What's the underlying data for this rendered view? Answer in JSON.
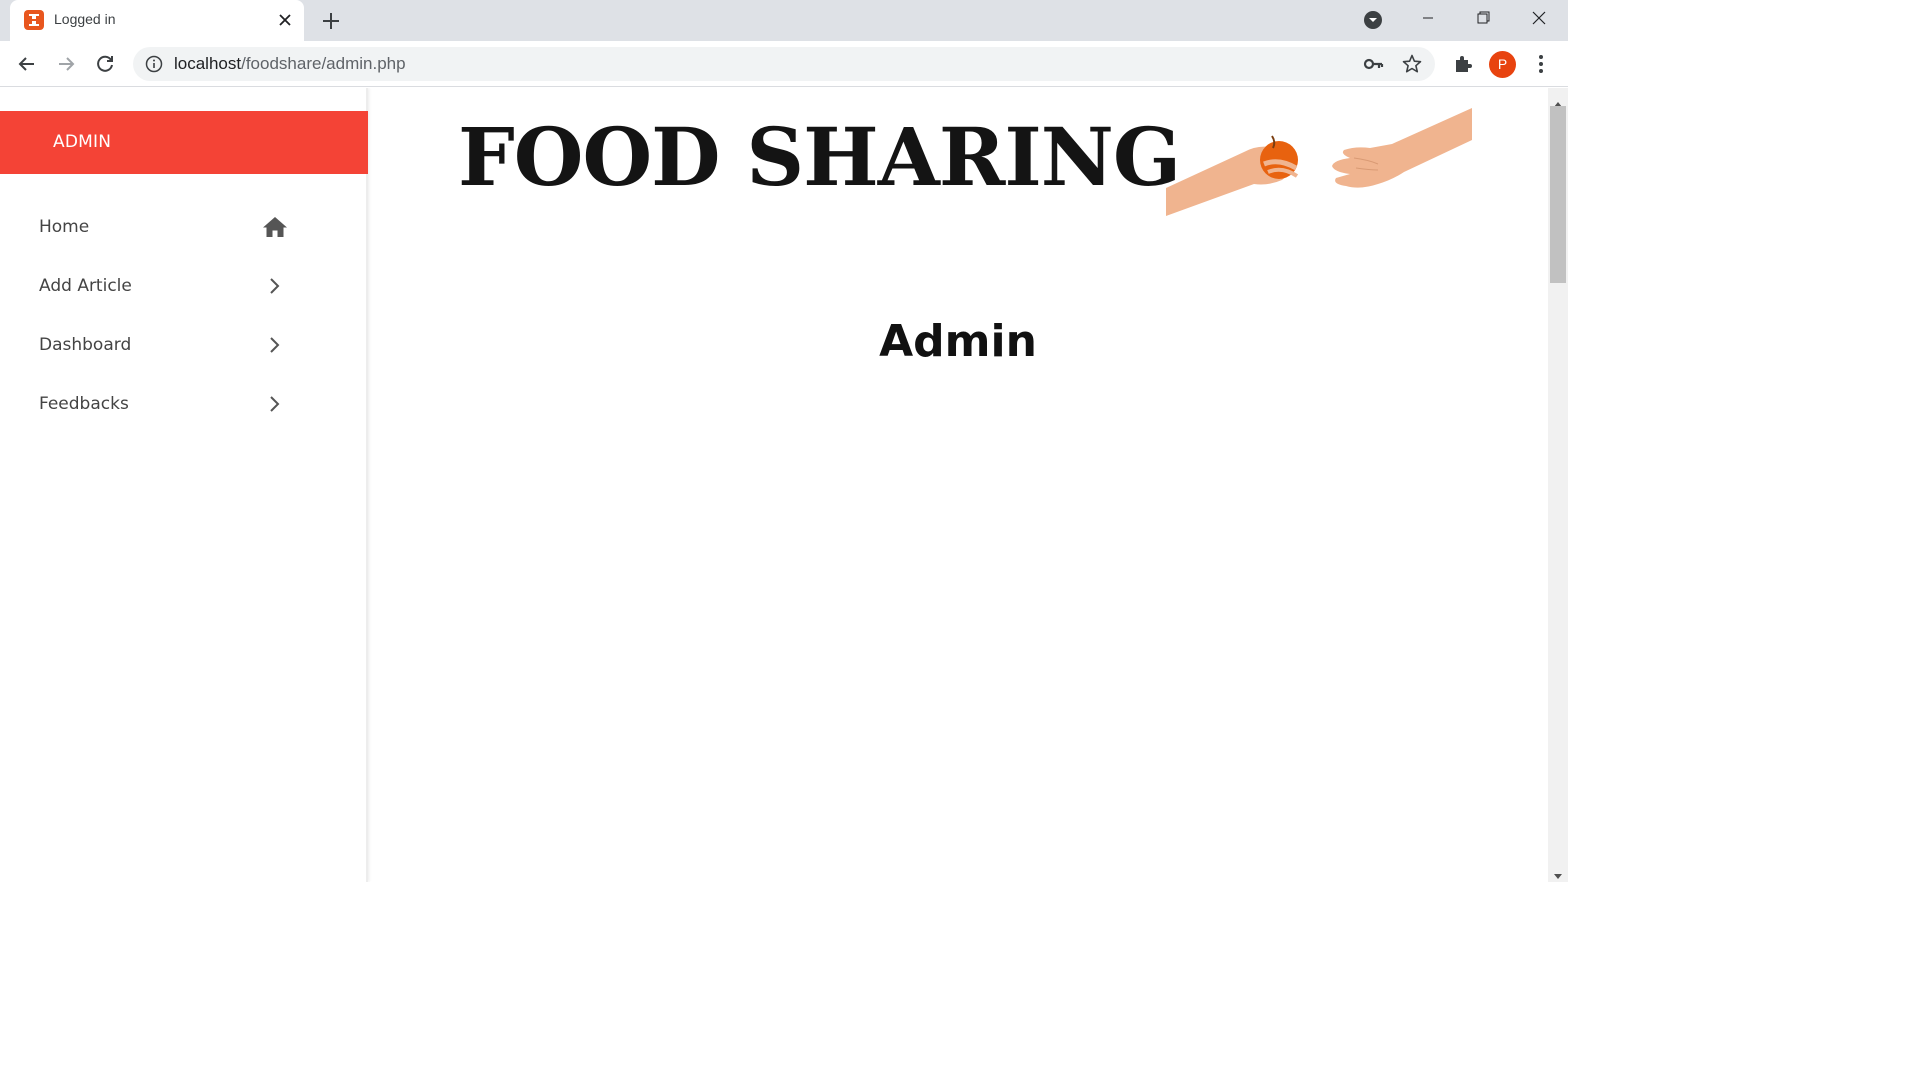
{
  "browser": {
    "tab_title": "Logged in",
    "url_host": "localhost",
    "url_path": "/foodshare/admin.php",
    "profile_initial": "P"
  },
  "sidebar": {
    "header": "ADMIN",
    "items": [
      {
        "label": "Home",
        "icon": "home-icon"
      },
      {
        "label": "Add Article",
        "icon": "chevron-right-icon"
      },
      {
        "label": "Dashboard",
        "icon": "chevron-right-icon"
      },
      {
        "label": "Feedbacks",
        "icon": "chevron-right-icon"
      }
    ]
  },
  "main": {
    "brand_title": "FOOD SHARING",
    "page_heading": "Admin"
  },
  "colors": {
    "accent": "#f44336",
    "profile": "#e8430f",
    "favicon": "#e8561e"
  }
}
